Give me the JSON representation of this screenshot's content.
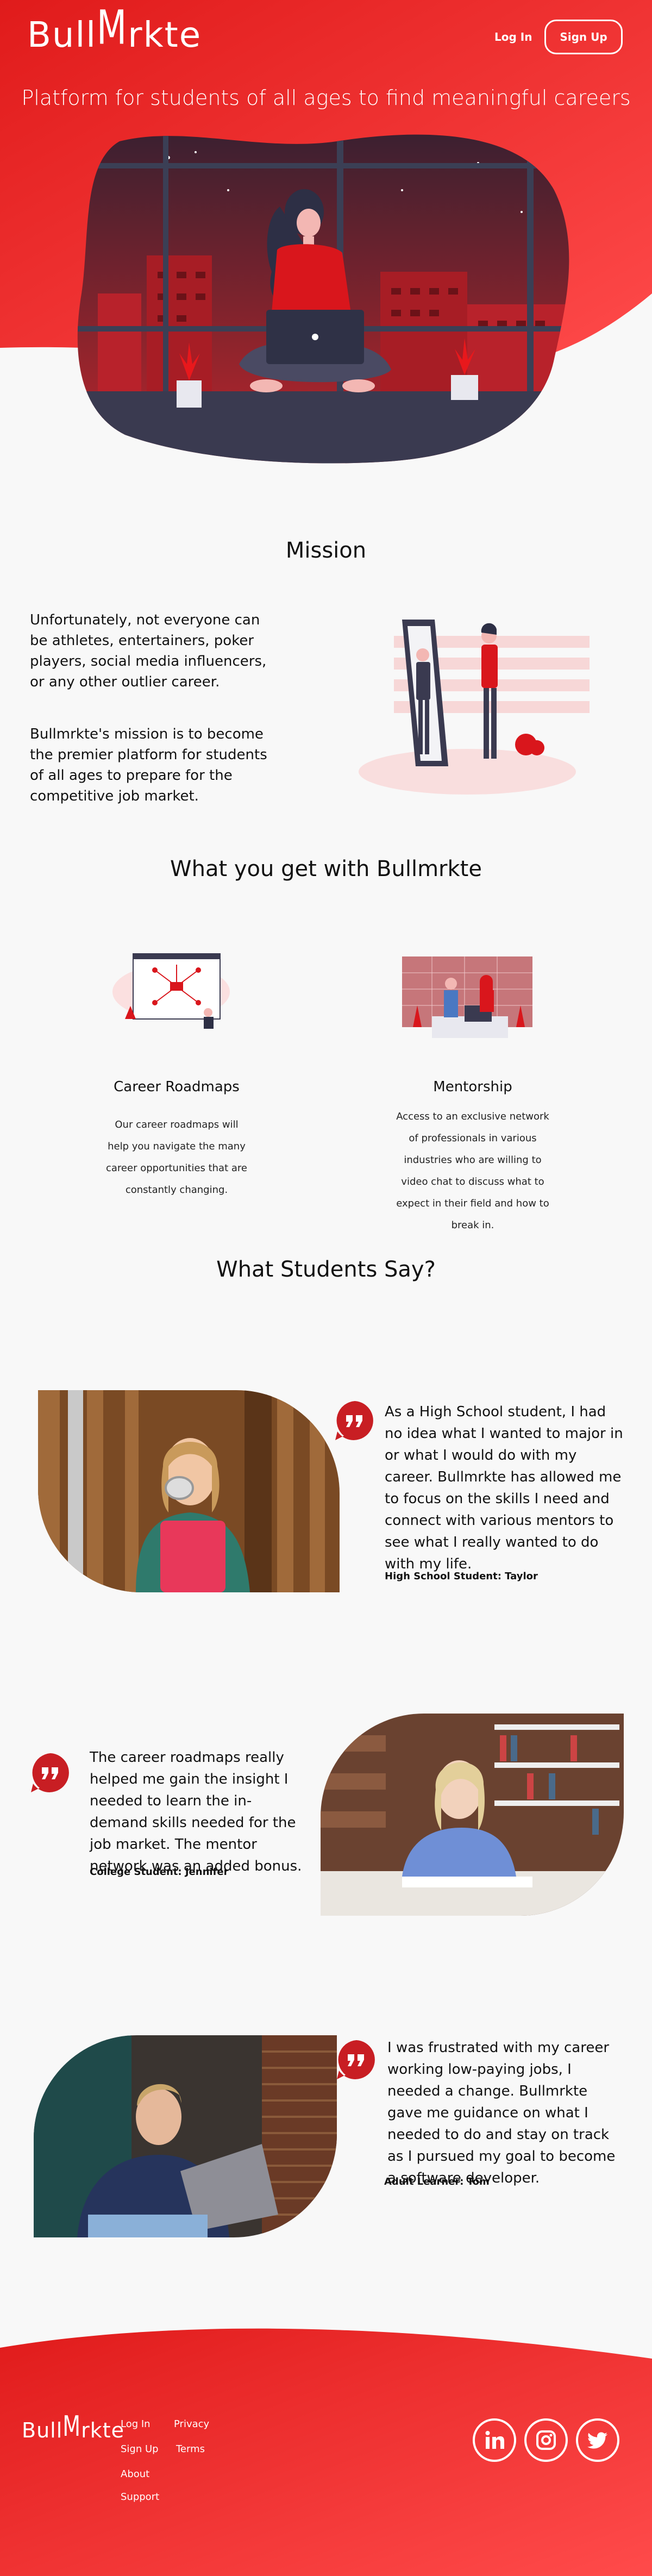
{
  "header": {
    "logo": "BullMrkte",
    "login_label": "Log In",
    "signup_label": "Sign Up",
    "tagline": "Platform for students of all ages to find meaningful careers"
  },
  "mission": {
    "title": "Mission",
    "paragraph_1": "Unfortunately, not everyone can be athletes, entertainers, poker players, social media influencers, or any other outlier career.",
    "paragraph_2": "Bullmrkte's mission is to become the premier platform for students of all ages to prepare for the competitive job market."
  },
  "features": {
    "title": "What you get with Bullmrkte",
    "items": [
      {
        "title": "Career Roadmaps",
        "description": "Our career roadmaps will help you navigate the many career opportunities that are constantly changing."
      },
      {
        "title": "Mentorship",
        "description": "Access to an exclusive network of professionals in various industries who are willing to video chat to discuss what to expect in their field and how to break in."
      }
    ]
  },
  "testimonials": {
    "title": "What Students Say?",
    "items": [
      {
        "quote": "As a High School student, I had no idea what I wanted to major in or what I would do with my career. Bullmrkte has allowed me to focus on the skills I need and connect with various mentors to see what I really wanted to do with my life.",
        "author": "High School Student: Taylor"
      },
      {
        "quote": "The career roadmaps really helped me gain the insight I needed to learn the in-demand skills needed for the job market. The mentor network was an added bonus.",
        "author": "College Student: Jennifer"
      },
      {
        "quote": "I was frustrated with my career working low-paying jobs, I needed a change. Bullmrkte gave me guidance on what I needed to do and stay on track as I pursued my goal to become a software developer.",
        "author": "Adult Learner: Tom"
      }
    ]
  },
  "footer": {
    "logo": "BullMrkte",
    "links": [
      "Log In",
      "Sign Up",
      "About",
      "Support",
      "Privacy",
      "Terms"
    ],
    "social": [
      "linkedin-icon",
      "instagram-icon",
      "twitter-icon"
    ]
  },
  "colors": {
    "brand_red": "#e8181c",
    "brand_red_light": "#ff4d4d",
    "dark_navy": "#3a3a50"
  }
}
